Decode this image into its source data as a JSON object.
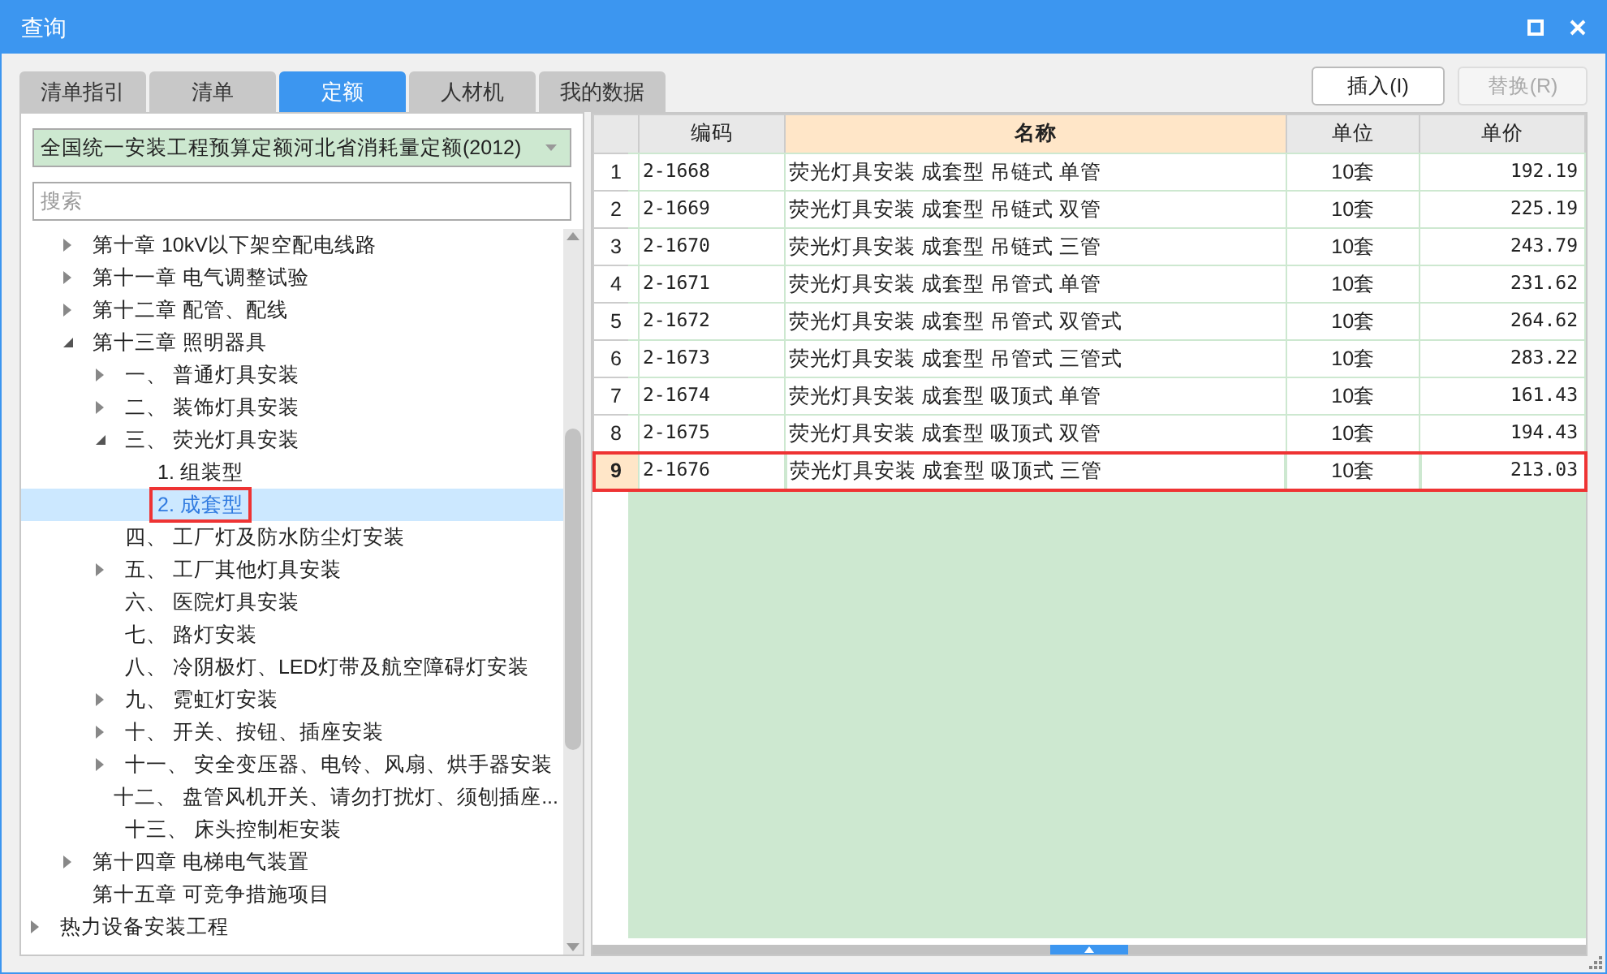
{
  "window": {
    "title": "查询"
  },
  "tabs": [
    {
      "label": "清单指引",
      "selected": false
    },
    {
      "label": "清单",
      "selected": false
    },
    {
      "label": "定额",
      "selected": true
    },
    {
      "label": "人材机",
      "selected": false
    },
    {
      "label": "我的数据",
      "selected": false
    }
  ],
  "buttons": [
    {
      "label": "插入(I)",
      "disabled": false
    },
    {
      "label": "替换(R)",
      "disabled": true
    }
  ],
  "library_dropdown": {
    "value": "全国统一安装工程预算定额河北省消耗量定额(2012)"
  },
  "search": {
    "placeholder": "搜索"
  },
  "tree": {
    "nested_items": [
      {
        "label": "第十章 10kV以下架空配电线路",
        "kind": "branch",
        "expanded": false,
        "selected": false,
        "marked": false
      },
      {
        "label": "第十一章 电气调整试验",
        "kind": "branch",
        "expanded": false,
        "selected": false,
        "marked": false
      },
      {
        "label": "第十二章 配管、配线",
        "kind": "branch",
        "expanded": false,
        "selected": false,
        "marked": false
      },
      {
        "label": "第十三章 照明器具",
        "kind": "branch",
        "expanded": true,
        "selected": false,
        "marked": false,
        "children": [
          {
            "label": "一、 普通灯具安装",
            "kind": "branch",
            "expanded": false,
            "selected": false,
            "marked": false
          },
          {
            "label": "二、 装饰灯具安装",
            "kind": "branch",
            "expanded": false,
            "selected": false,
            "marked": false
          },
          {
            "label": "三、 荧光灯具安装",
            "kind": "branch",
            "expanded": true,
            "selected": false,
            "marked": false,
            "children": [
              {
                "label": "1. 组装型",
                "kind": "leaf",
                "selected": false,
                "marked": false
              },
              {
                "label": "2. 成套型",
                "kind": "leaf",
                "selected": true,
                "marked": true
              }
            ]
          },
          {
            "label": "四、 工厂灯及防水防尘灯安装",
            "kind": "leaf",
            "selected": false,
            "marked": false
          },
          {
            "label": "五、 工厂其他灯具安装",
            "kind": "branch",
            "expanded": false,
            "selected": false,
            "marked": false
          },
          {
            "label": "六、 医院灯具安装",
            "kind": "leaf",
            "selected": false,
            "marked": false
          },
          {
            "label": "七、 路灯安装",
            "kind": "leaf",
            "selected": false,
            "marked": false
          },
          {
            "label": "八、 冷阴极灯、LED灯带及航空障碍灯安装",
            "kind": "leaf",
            "selected": false,
            "marked": false
          },
          {
            "label": "九、 霓虹灯安装",
            "kind": "branch",
            "expanded": false,
            "selected": false,
            "marked": false
          },
          {
            "label": "十、 开关、按钮、插座安装",
            "kind": "branch",
            "expanded": false,
            "selected": false,
            "marked": false
          },
          {
            "label": "十一、 安全变压器、电铃、风扇、烘手器安装",
            "kind": "branch",
            "expanded": false,
            "selected": false,
            "marked": false
          },
          {
            "label": "十二、 盘管风机开关、请勿打扰灯、须刨插座...",
            "kind": "leaf",
            "selected": false,
            "marked": false
          },
          {
            "label": "十三、 床头控制柜安装",
            "kind": "leaf",
            "selected": false,
            "marked": false
          }
        ]
      },
      {
        "label": "第十四章 电梯电气装置",
        "kind": "branch",
        "expanded": false,
        "selected": false,
        "marked": false
      },
      {
        "label": "第十五章 可竞争措施项目",
        "kind": "leaf",
        "selected": false,
        "marked": false
      }
    ],
    "root_items": [
      {
        "label": "热力设备安装工程",
        "kind": "branch",
        "expanded": false,
        "selected": false,
        "marked": false
      }
    ]
  },
  "table": {
    "columns": [
      {
        "label": "编码",
        "selected": false
      },
      {
        "label": "名称",
        "selected": true
      },
      {
        "label": "单位",
        "selected": false
      },
      {
        "label": "单价",
        "selected": false
      }
    ],
    "rows": [
      {
        "number": "1",
        "code": "2-1668",
        "name": "荧光灯具安装 成套型 吊链式 单管",
        "unit": "10套",
        "price": "192.19",
        "selected": false,
        "marked": false
      },
      {
        "number": "2",
        "code": "2-1669",
        "name": "荧光灯具安装 成套型 吊链式 双管",
        "unit": "10套",
        "price": "225.19",
        "selected": false,
        "marked": false
      },
      {
        "number": "3",
        "code": "2-1670",
        "name": "荧光灯具安装 成套型 吊链式 三管",
        "unit": "10套",
        "price": "243.79",
        "selected": false,
        "marked": false
      },
      {
        "number": "4",
        "code": "2-1671",
        "name": "荧光灯具安装 成套型 吊管式 单管",
        "unit": "10套",
        "price": "231.62",
        "selected": false,
        "marked": false
      },
      {
        "number": "5",
        "code": "2-1672",
        "name": "荧光灯具安装 成套型 吊管式 双管式",
        "unit": "10套",
        "price": "264.62",
        "selected": false,
        "marked": false
      },
      {
        "number": "6",
        "code": "2-1673",
        "name": "荧光灯具安装 成套型 吊管式 三管式",
        "unit": "10套",
        "price": "283.22",
        "selected": false,
        "marked": false
      },
      {
        "number": "7",
        "code": "2-1674",
        "name": "荧光灯具安装 成套型 吸顶式 单管",
        "unit": "10套",
        "price": "161.43",
        "selected": false,
        "marked": false
      },
      {
        "number": "8",
        "code": "2-1675",
        "name": "荧光灯具安装 成套型 吸顶式 双管",
        "unit": "10套",
        "price": "194.43",
        "selected": false,
        "marked": false
      },
      {
        "number": "9",
        "code": "2-1676",
        "name": "荧光灯具安装 成套型 吸顶式 三管",
        "unit": "10套",
        "price": "213.03",
        "selected": true,
        "marked": true
      }
    ]
  }
}
